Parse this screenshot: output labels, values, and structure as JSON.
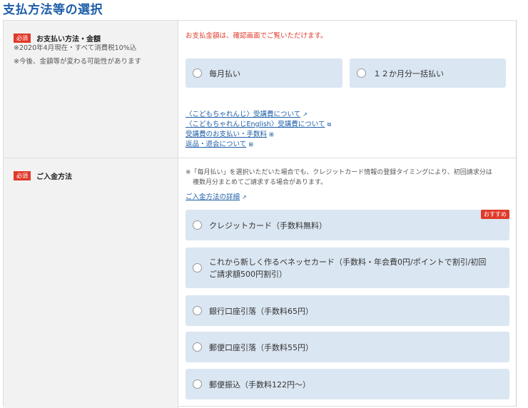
{
  "title": "支払方法等の選択",
  "required": "必須",
  "section1": {
    "label": "お支払い方法・金額",
    "note1": "※2020年4月現在・すべて消費税10%込",
    "note2": "※今後、金額等が変わる可能性があります",
    "notice": "お支払金額は、確認画面でご覧いただけます。",
    "options": [
      "毎月払い",
      "１２か月分一括払い"
    ],
    "links": [
      "〈こどもちゃれんじ〉受講費について",
      "〈こどもちゃれんじEnglish〉受講費について",
      "受講費のお支払い・手数料",
      "返品・退会について"
    ]
  },
  "section2": {
    "label": "ご入金方法",
    "note": "※「毎月払い」を選択いただいた場合でも、クレジットカード情報の登録タイミングにより、初回請求分は",
    "note_cont": "複数月分まとめてご請求する場合があります。",
    "link": "ご入金方法の詳細",
    "badge": "おすすめ",
    "options": [
      "クレジットカード（手数料無料）",
      "これから新しく作るベネッセカード（手数料・年会費0円/ポイントで割引/初回",
      "ご請求額500円割引）",
      "銀行口座引落（手数料65円）",
      "郵便口座引落（手数料55円）",
      "郵便振込（手数料122円〜）"
    ]
  },
  "colors": {
    "accent": "#1d5ea8",
    "required": "#e0392b",
    "option_bg": "#dae6f2"
  }
}
